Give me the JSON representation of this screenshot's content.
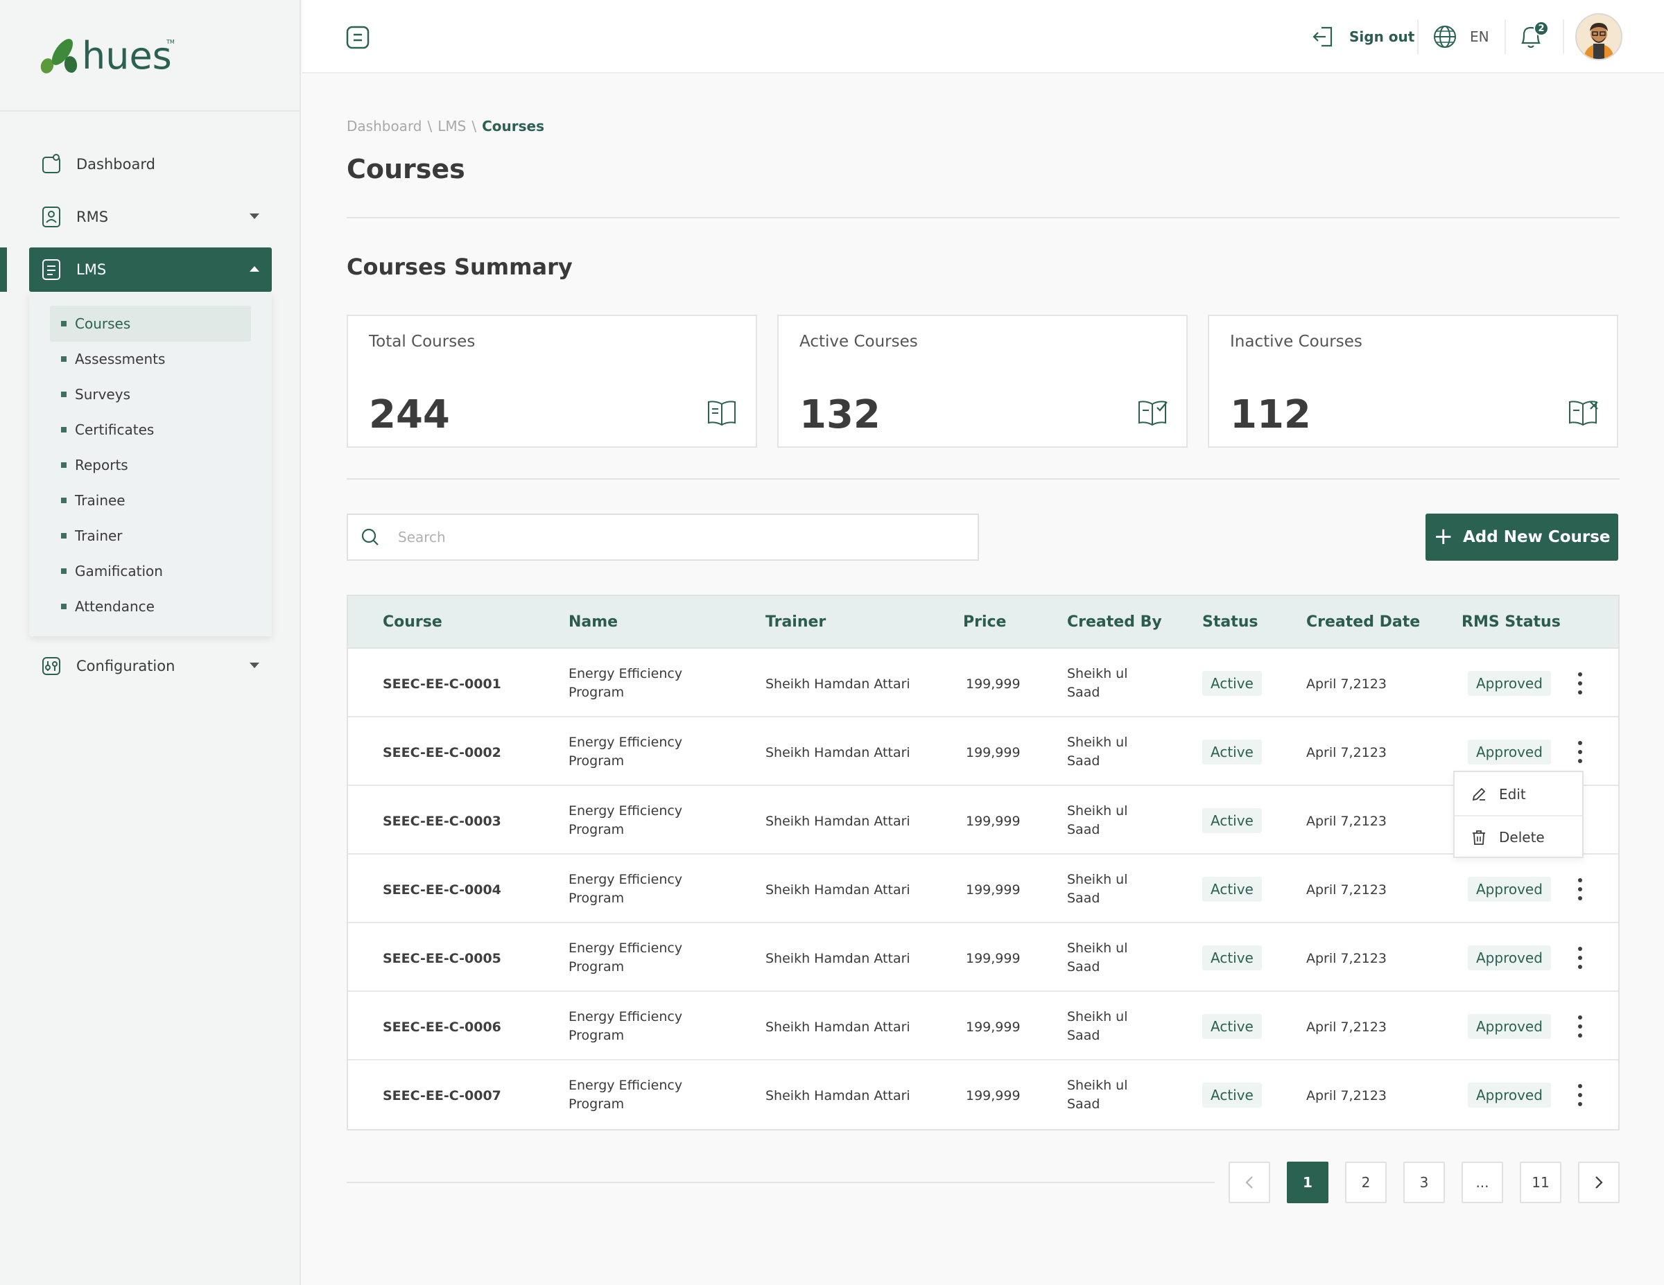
{
  "brand": {
    "name": "hues",
    "trademark": "TM"
  },
  "sidebar": {
    "items": [
      {
        "label": "Dashboard"
      },
      {
        "label": "RMS"
      },
      {
        "label": "LMS"
      },
      {
        "label": "Configuration"
      }
    ],
    "lms_submenu": [
      "Courses",
      "Assessments",
      "Surveys",
      "Certificates",
      "Reports",
      "Trainee",
      "Trainer",
      "Gamification",
      "Attendance"
    ]
  },
  "header": {
    "sign_out": "Sign out",
    "language": "EN",
    "notification_count": "2"
  },
  "breadcrumb": [
    "Dashboard",
    "\\",
    "LMS",
    "\\",
    "Courses"
  ],
  "page_title": "Courses",
  "summary": {
    "title": "Courses Summary",
    "cards": [
      {
        "label": "Total Courses",
        "value": "244",
        "icon": "open-book-icon"
      },
      {
        "label": "Active Courses",
        "value": "132",
        "icon": "book-check-icon"
      },
      {
        "label": "Inactive Courses",
        "value": "112",
        "icon": "book-x-icon"
      }
    ]
  },
  "search": {
    "placeholder": "Search",
    "value": ""
  },
  "add_button": "Add New Course",
  "table": {
    "columns": [
      "Course",
      "Name",
      "Trainer",
      "Price",
      "Created By",
      "Status",
      "Created Date",
      "RMS Status"
    ],
    "rows": [
      {
        "course": "SEEC-EE-C-0001",
        "name1": "Energy Efficiency",
        "name2": "Program",
        "trainer": "Sheikh Hamdan Attari",
        "price": "199,999",
        "by1": "Sheikh ul",
        "by2": "Saad",
        "status": "Active",
        "date": "April 7,2123",
        "rms": "Approved"
      },
      {
        "course": "SEEC-EE-C-0002",
        "name1": "Energy Efficiency",
        "name2": "Program",
        "trainer": "Sheikh Hamdan Attari",
        "price": "199,999",
        "by1": "Sheikh ul",
        "by2": "Saad",
        "status": "Active",
        "date": "April 7,2123",
        "rms": "Approved"
      },
      {
        "course": "SEEC-EE-C-0003",
        "name1": "Energy Efficiency",
        "name2": "Program",
        "trainer": "Sheikh Hamdan Attari",
        "price": "199,999",
        "by1": "Sheikh ul",
        "by2": "Saad",
        "status": "Active",
        "date": "April 7,2123",
        "rms": ""
      },
      {
        "course": "SEEC-EE-C-0004",
        "name1": "Energy Efficiency",
        "name2": "Program",
        "trainer": "Sheikh Hamdan Attari",
        "price": "199,999",
        "by1": "Sheikh ul",
        "by2": "Saad",
        "status": "Active",
        "date": "April 7,2123",
        "rms": "Approved"
      },
      {
        "course": "SEEC-EE-C-0005",
        "name1": "Energy Efficiency",
        "name2": "Program",
        "trainer": "Sheikh Hamdan Attari",
        "price": "199,999",
        "by1": "Sheikh ul",
        "by2": "Saad",
        "status": "Active",
        "date": "April 7,2123",
        "rms": "Approved"
      },
      {
        "course": "SEEC-EE-C-0006",
        "name1": "Energy Efficiency",
        "name2": "Program",
        "trainer": "Sheikh Hamdan Attari",
        "price": "199,999",
        "by1": "Sheikh ul",
        "by2": "Saad",
        "status": "Active",
        "date": "April 7,2123",
        "rms": "Approved"
      },
      {
        "course": "SEEC-EE-C-0007",
        "name1": "Energy Efficiency",
        "name2": "Program",
        "trainer": "Sheikh Hamdan Attari",
        "price": "199,999",
        "by1": "Sheikh ul",
        "by2": "Saad",
        "status": "Active",
        "date": "April 7,2123",
        "rms": "Approved"
      }
    ]
  },
  "row_menu": {
    "edit": "Edit",
    "delete": "Delete"
  },
  "pagination": {
    "pages": [
      "1",
      "2",
      "3",
      "...",
      "11"
    ],
    "current": "1"
  },
  "colors": {
    "primary": "#2a6150",
    "header_row": "#e6efed",
    "pill_bg": "#eef4f2",
    "sidebar_bg": "#f3f4f4"
  }
}
